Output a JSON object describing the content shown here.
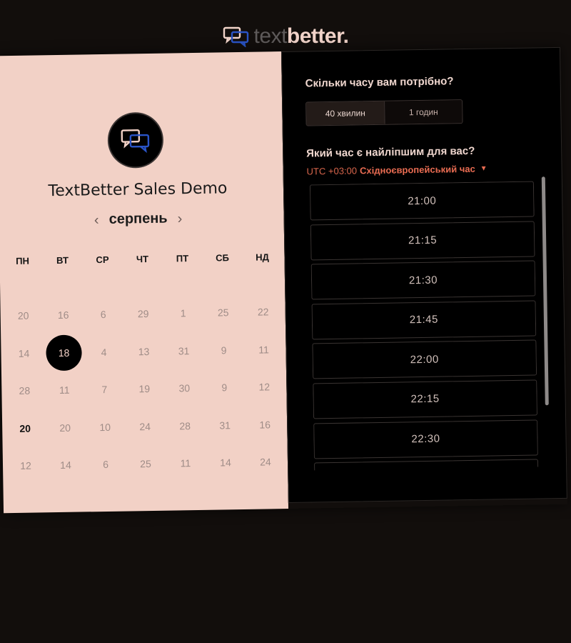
{
  "header": {
    "logo_text_light": "text",
    "logo_text_bold": "better.",
    "logo_icon": "chat-bubbles-icon"
  },
  "event": {
    "title": "TextBetter Sales Demo",
    "avatar_icon": "chat-bubbles-icon"
  },
  "calendar": {
    "month": "серпень",
    "prev_icon": "chevron-left-icon",
    "next_icon": "chevron-right-icon",
    "weekdays": [
      "ПН",
      "ВТ",
      "СР",
      "ЧТ",
      "ПТ",
      "СБ",
      "НД"
    ],
    "days": [
      [
        "20",
        "16",
        "6",
        "29",
        "1",
        "25",
        "22"
      ],
      [
        "14",
        "18",
        "4",
        "13",
        "31",
        "9",
        "11"
      ],
      [
        "28",
        "11",
        "7",
        "19",
        "30",
        "9",
        "12"
      ],
      [
        "20",
        "20",
        "10",
        "24",
        "28",
        "31",
        "16"
      ],
      [
        "12",
        "14",
        "6",
        "25",
        "11",
        "14",
        "24"
      ]
    ],
    "selected_day": "18",
    "highlighted_day": "20"
  },
  "duration": {
    "question": "Скільки часу вам потрібно?",
    "options": [
      "40 хвилин",
      "1 годин"
    ],
    "selected": "40 хвилин"
  },
  "time": {
    "question": "Який час є найліпшим для вас?",
    "timezone_offset": "UTC +03:00",
    "timezone_name": "Східноєвропейський час",
    "caret_icon": "caret-down-icon",
    "slots": [
      "21:00",
      "21:15",
      "21:30",
      "21:45",
      "22:00",
      "22:15",
      "22:30",
      ""
    ]
  },
  "colors": {
    "left_bg": "#f2d1c6",
    "right_bg": "#000000",
    "accent": "#e96c52",
    "page_bg": "#120e0c"
  }
}
